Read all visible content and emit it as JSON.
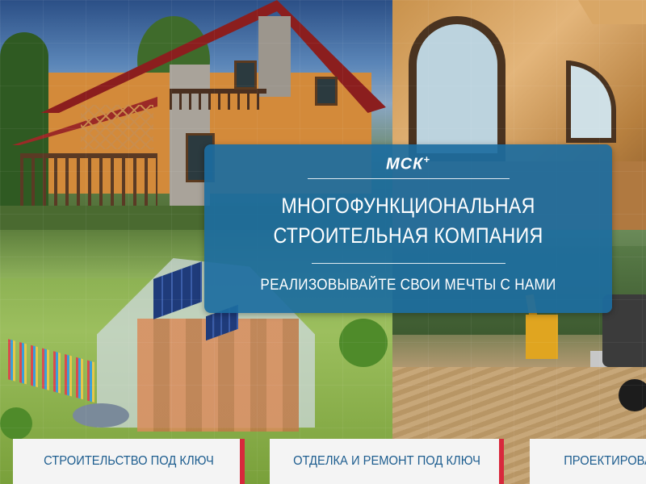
{
  "brand": {
    "logo": "МСК",
    "logo_sup": "+"
  },
  "banner": {
    "title_line1": "МНОГОФУНКЦИОНАЛЬНАЯ",
    "title_line2": "СТРОИТЕЛЬНАЯ КОМПАНИЯ",
    "slogan": "РЕАЛИЗОВЫВАЙТЕ СВОИ МЕЧТЫ С НАМИ"
  },
  "services": [
    {
      "label": "СТРОИТЕЛЬСТВО ПОД КЛЮЧ"
    },
    {
      "label": "ОТДЕЛКА И РЕМОНТ ПОД КЛЮЧ"
    },
    {
      "label": "ПРОЕКТИРОВАН"
    }
  ],
  "colors": {
    "banner_bg": "#1c6ca0",
    "button_text": "#1d5d8f",
    "button_accent": "#d8283c",
    "button_bg": "#f4f4f4"
  }
}
